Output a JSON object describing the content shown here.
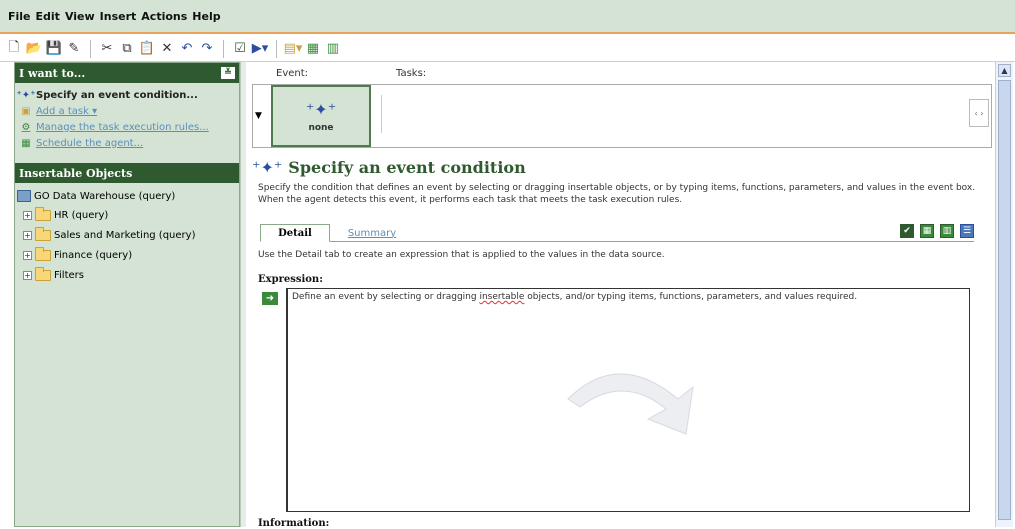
{
  "menu": [
    "File",
    "Edit",
    "View",
    "Insert",
    "Actions",
    "Help"
  ],
  "toolbar_icons": [
    "new-icon",
    "open-icon",
    "save-icon",
    "edit-icon",
    "cut-icon",
    "copy-icon",
    "paste-icon",
    "delete-icon",
    "undo-icon",
    "redo-icon",
    "validate-icon",
    "run-icon",
    "properties-icon",
    "grid-icon",
    "report-icon"
  ],
  "left_panel": {
    "i_want_to_title": "I want to...",
    "items": [
      {
        "label": "Specify an event condition...",
        "icon": "event-icon",
        "type": "primary"
      },
      {
        "label": "Add a task ▾",
        "icon": "task-icon",
        "type": "link"
      },
      {
        "label": "Manage the task execution rules...",
        "icon": "rules-icon",
        "type": "link"
      },
      {
        "label": "Schedule the agent...",
        "icon": "schedule-icon",
        "type": "link"
      }
    ],
    "insertable_title": "Insertable Objects",
    "tree_root": "GO Data Warehouse (query)",
    "tree_nodes": [
      "HR (query)",
      "Sales and Marketing (query)",
      "Finance (query)",
      "Filters"
    ]
  },
  "event_strip": {
    "event_label": "Event:",
    "tasks_label": "Tasks:",
    "event_box_label": "none"
  },
  "main": {
    "heading": "Specify an event condition",
    "description": "Specify the condition that defines an event by selecting or dragging insertable objects, or by typing items, functions, parameters, and values in the event box. When the agent detects this event, it performs each task that meets the task execution rules.",
    "tabs": {
      "detail": "Detail",
      "summary": "Summary"
    },
    "detail_description": "Use the Detail tab to create an expression that is applied to the values in the data source.",
    "expression_label": "Expression:",
    "expression_text_before": "Define an event by selecting or dragging ",
    "expression_text_word": "insertable",
    "expression_text_after": " objects, and/or typing items, functions, parameters, and values required.",
    "information_label": "Information:"
  }
}
